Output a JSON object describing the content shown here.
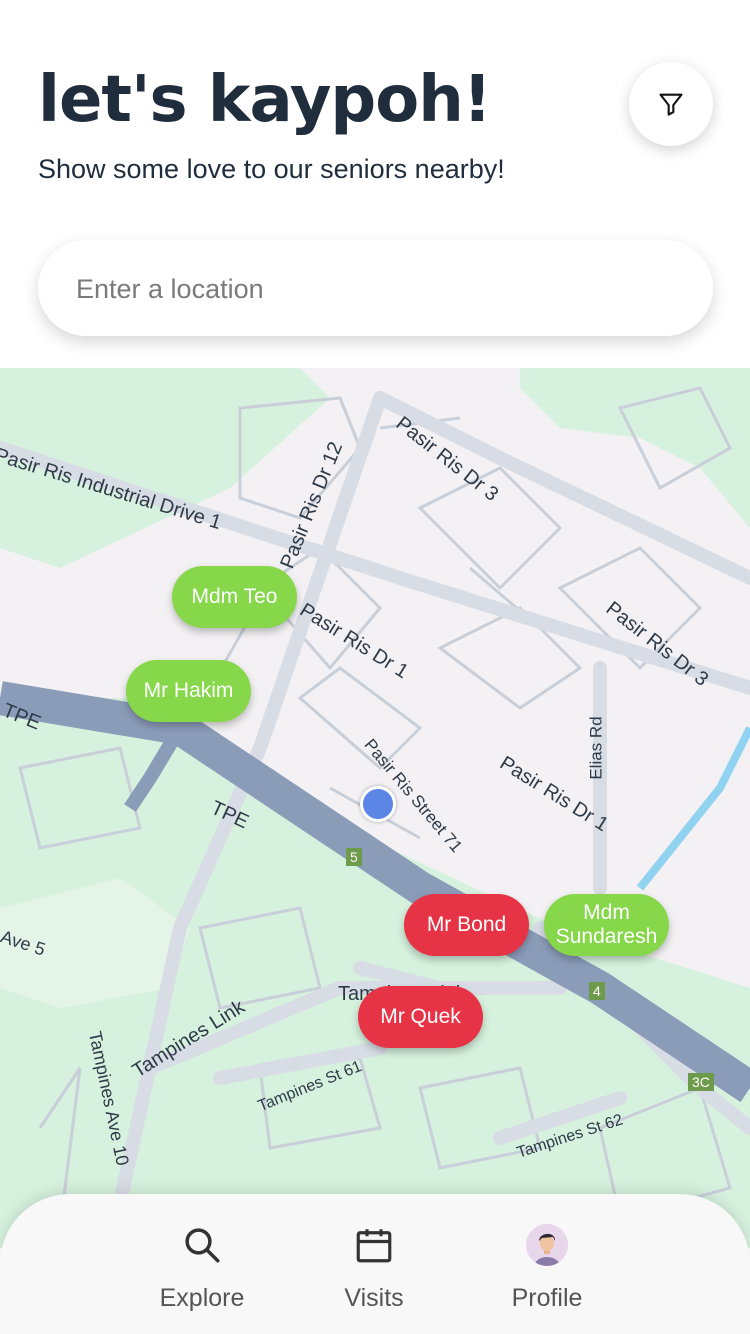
{
  "header": {
    "title": "let's kaypoh!",
    "subtitle": "Show some love to our seniors nearby!"
  },
  "search": {
    "placeholder": "Enter a location",
    "value": ""
  },
  "filter_icon": "filter-funnel-icon",
  "map": {
    "road_labels": [
      "Pasir Ris Industrial Drive 1",
      "Pasir Ris Dr 12",
      "Pasir Ris Dr 3",
      "Pasir Ris Dr 3",
      "Pasir Ris Dr 1",
      "Pasir Ris Dr 1",
      "Pasir Ris Street 71",
      "Elias Rd",
      "TPE",
      "TPE",
      "Tampines Link",
      "Tampines Link",
      "Tampines St 61",
      "Tampines St 62",
      "Tampines Ave 10",
      "Ave 5"
    ],
    "exit_badges": [
      "5",
      "4",
      "3C"
    ],
    "seniors": [
      {
        "name": "Mdm Teo",
        "status": "green"
      },
      {
        "name": "Mr Hakim",
        "status": "green"
      },
      {
        "name": "Mr Bond",
        "status": "red"
      },
      {
        "name": "Mdm Sundaresh",
        "status": "green"
      },
      {
        "name": "Mr Quek",
        "status": "red"
      }
    ],
    "colors": {
      "green_pin": "#86d74a",
      "red_pin": "#e63446",
      "user_location": "#5b86e5",
      "expressway": "#8b9cb9",
      "park": "#d6f1dd"
    }
  },
  "nav": {
    "items": [
      {
        "label": "Explore",
        "icon": "search-icon"
      },
      {
        "label": "Visits",
        "icon": "calendar-icon"
      },
      {
        "label": "Profile",
        "icon": "avatar"
      }
    ]
  }
}
